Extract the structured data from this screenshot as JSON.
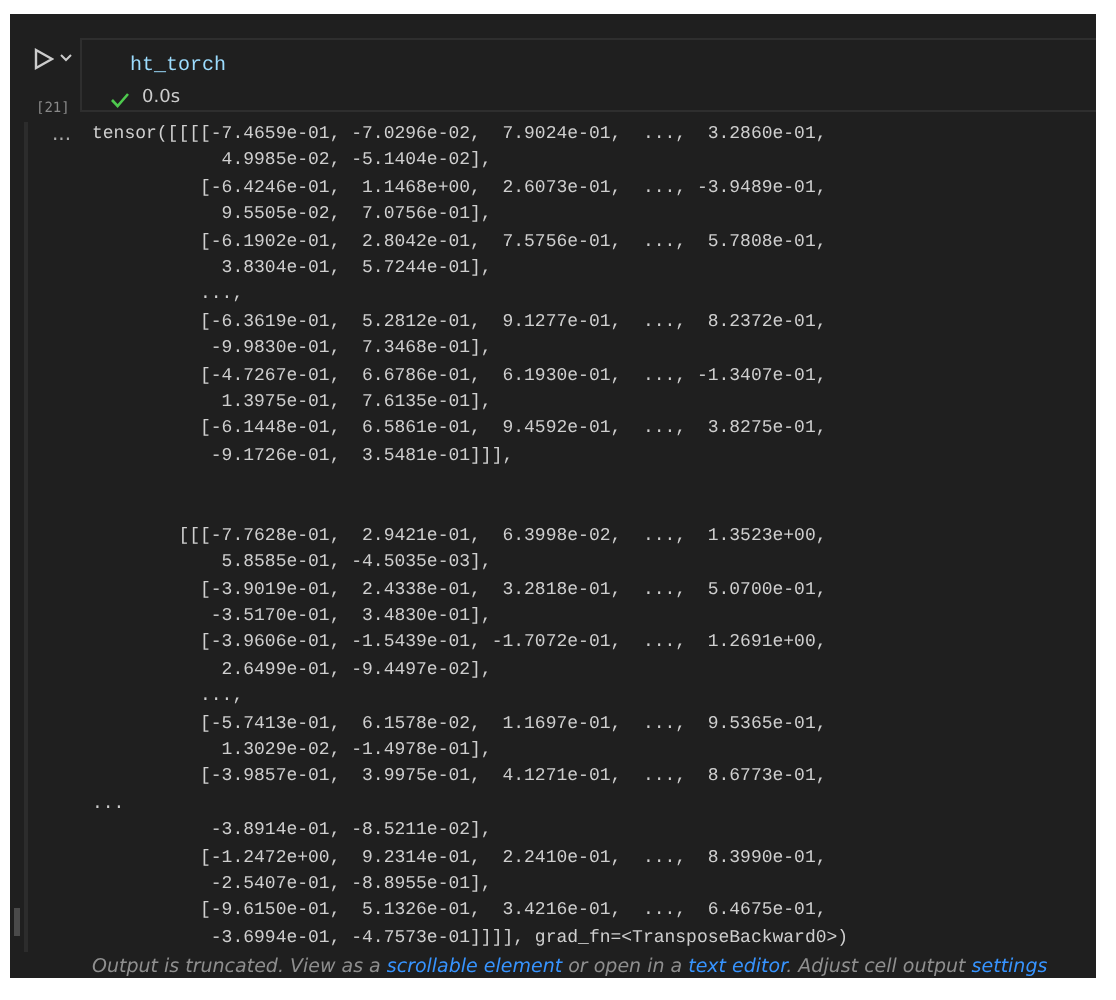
{
  "cell": {
    "execution_count": "[21]",
    "code": "ht_torch",
    "status": {
      "succeeded": true,
      "duration": "0.0s"
    }
  },
  "output": {
    "more": "...",
    "blocks": [
      {
        "lines": [
          "tensor([[[[-7.4659e-01, -7.0296e-02,  7.9024e-01,  ...,  3.2860e-01,",
          "            4.9985e-02, -5.1404e-02],",
          "          [-6.4246e-01,  1.1468e+00,  2.6073e-01,  ..., -3.9489e-01,",
          "            9.5505e-02,  7.0756e-01],",
          "          [-6.1902e-01,  2.8042e-01,  7.5756e-01,  ...,  5.7808e-01,",
          "            3.8304e-01,  5.7244e-01],",
          "          ...,",
          "          [-6.3619e-01,  5.2812e-01,  9.1277e-01,  ...,  8.2372e-01,",
          "           -9.9830e-01,  7.3468e-01],",
          "          [-4.7267e-01,  6.6786e-01,  6.1930e-01,  ..., -1.3407e-01,",
          "            1.3975e-01,  7.6135e-01],",
          "          [-6.1448e-01,  6.5861e-01,  9.4592e-01,  ...,  3.8275e-01,",
          "           -9.1726e-01,  3.5481e-01]]],"
        ]
      },
      {
        "lines": [
          "        [[[-7.7628e-01,  2.9421e-01,  6.3998e-02,  ...,  1.3523e+00,",
          "            5.8585e-01, -4.5035e-03],",
          "          [-3.9019e-01,  2.4338e-01,  3.2818e-01,  ...,  5.0700e-01,",
          "           -3.5170e-01,  3.4830e-01],",
          "          [-3.9606e-01, -1.5439e-01, -1.7072e-01,  ...,  1.2691e+00,",
          "            2.6499e-01, -9.4497e-02],",
          "          ...,",
          "          [-5.7413e-01,  6.1578e-02,  1.1697e-01,  ...,  9.5365e-01,",
          "            1.3029e-02, -1.4978e-01],",
          "          [-3.9857e-01,  3.9975e-01,  4.1271e-01,  ...,  8.6773e-01,",
          "...",
          "           -3.8914e-01, -8.5211e-02],",
          "          [-1.2472e+00,  9.2314e-01,  2.2410e-01,  ...,  8.3990e-01,",
          "           -2.5407e-01, -8.8955e-01],",
          "          [-9.6150e-01,  5.1326e-01,  3.4216e-01,  ...,  6.4675e-01,",
          "           -3.6994e-01, -4.7573e-01]]]], grad_fn=<TransposeBackward0>)"
        ]
      }
    ],
    "footer": [
      {
        "kind": "text",
        "text": "Output is truncated. View as a "
      },
      {
        "kind": "link",
        "text": "scrollable element"
      },
      {
        "kind": "text",
        "text": " or open in a "
      },
      {
        "kind": "link",
        "text": "text editor"
      },
      {
        "kind": "text",
        "text": ". Adjust cell output "
      },
      {
        "kind": "link",
        "text": "settings"
      }
    ]
  }
}
